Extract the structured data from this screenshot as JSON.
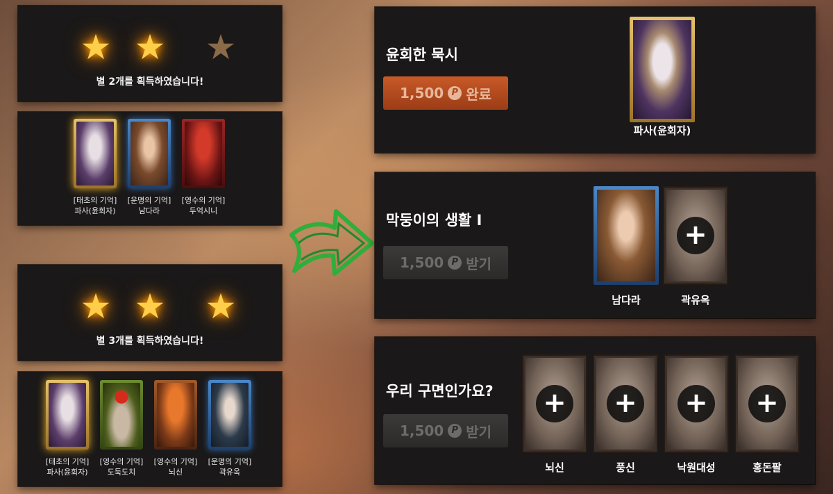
{
  "left": {
    "top_stars": {
      "earned": 2,
      "total": 3,
      "message": "별 2개를 획득하였습니다!"
    },
    "top_cards": [
      {
        "line1": "[태초의 기억]",
        "line2": "파사(윤회자)",
        "frame": "gold"
      },
      {
        "line1": "[운명의 기억]",
        "line2": "남다라",
        "frame": "blue"
      },
      {
        "line1": "[영수의 기억]",
        "line2": "두억시니",
        "frame": "red"
      }
    ],
    "bottom_stars": {
      "earned": 3,
      "total": 3,
      "message": "별 3개를 획득하였습니다!"
    },
    "bottom_cards": [
      {
        "line1": "[태초의 기억]",
        "line2": "파사(윤회자)",
        "frame": "gold"
      },
      {
        "line1": "[영수의 기억]",
        "line2": "도둑도치",
        "frame": "green"
      },
      {
        "line1": "[영수의 기억]",
        "line2": "뇌신",
        "frame": "orange"
      },
      {
        "line1": "[운명의 기억]",
        "line2": "곽유옥",
        "frame": "blue"
      }
    ]
  },
  "quests": [
    {
      "title": "윤회한 묵시",
      "reward_amount": "1,500",
      "coin_symbol": "P",
      "action_label": "완료",
      "state": "done",
      "cards": [
        {
          "name": "파사(윤회자)",
          "owned": true
        }
      ]
    },
    {
      "title": "막둥이의 생활 I",
      "reward_amount": "1,500",
      "coin_symbol": "P",
      "action_label": "받기",
      "state": "get",
      "cards": [
        {
          "name": "남다라",
          "owned": true
        },
        {
          "name": "곽유옥",
          "owned": false
        }
      ]
    },
    {
      "title": "우리 구면인가요?",
      "reward_amount": "1,500",
      "coin_symbol": "P",
      "action_label": "받기",
      "state": "get",
      "cards": [
        {
          "name": "뇌신",
          "owned": false
        },
        {
          "name": "풍신",
          "owned": false
        },
        {
          "name": "낙원대성",
          "owned": false
        },
        {
          "name": "홍돈팔",
          "owned": false
        }
      ]
    }
  ],
  "icons": {
    "star": "star-icon",
    "coin": "coin-icon",
    "plus": "plus-icon",
    "arrow": "arrow-icon"
  },
  "colors": {
    "star_on": "#ffcf4a",
    "star_off": "#8a6a48",
    "done_button": "#c85a28",
    "get_button": "#3c3a39",
    "arrow": "#2fae3a"
  }
}
